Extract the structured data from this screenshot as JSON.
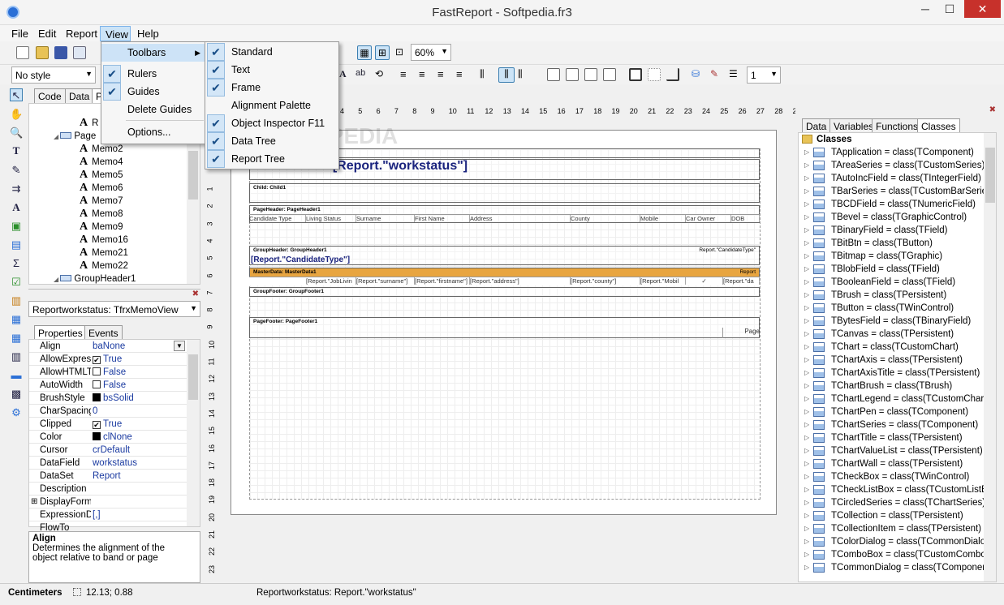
{
  "window": {
    "title": "FastReport - Softpedia.fr3",
    "min": "─",
    "max": "☐",
    "close": "✕"
  },
  "menubar": [
    "File",
    "Edit",
    "Report",
    "View",
    "Help"
  ],
  "toolbar": {
    "zoom": "60%",
    "style": "No style",
    "frame_width": "1"
  },
  "tree_tabs": [
    "Code",
    "Data",
    "P"
  ],
  "tree_items": [
    "R",
    "Page",
    "Memo2",
    "Memo4",
    "Memo5",
    "Memo6",
    "Memo7",
    "Memo8",
    "Memo9",
    "Memo16",
    "Memo21",
    "Memo22",
    "GroupHeader1"
  ],
  "object_selector": "Reportworkstatus: TfrxMemoView",
  "prop_tabs": [
    "Properties",
    "Events"
  ],
  "properties": [
    {
      "name": "Align",
      "value": "baNone",
      "kind": "drop"
    },
    {
      "name": "AllowExpress",
      "value": "True",
      "kind": "check"
    },
    {
      "name": "AllowHTMLTa",
      "value": "False",
      "kind": "uncheck"
    },
    {
      "name": "AutoWidth",
      "value": "False",
      "kind": "uncheck"
    },
    {
      "name": "BrushStyle",
      "value": "bsSolid",
      "kind": "swatch"
    },
    {
      "name": "CharSpacing",
      "value": "0",
      "kind": "text"
    },
    {
      "name": "Clipped",
      "value": "True",
      "kind": "check"
    },
    {
      "name": "Color",
      "value": "clNone",
      "kind": "swatch"
    },
    {
      "name": "Cursor",
      "value": "crDefault",
      "kind": "text"
    },
    {
      "name": "DataField",
      "value": "workstatus",
      "kind": "text"
    },
    {
      "name": "DataSet",
      "value": "Report",
      "kind": "text"
    },
    {
      "name": "Description",
      "value": "",
      "kind": "text"
    },
    {
      "name": "DisplayForma",
      "value": "",
      "kind": "expand"
    },
    {
      "name": "ExpressionDe",
      "value": "[,]",
      "kind": "text"
    },
    {
      "name": "FlowTo",
      "value": "",
      "kind": "text"
    }
  ],
  "help": {
    "title": "Align",
    "text": "Determines the alignment of the object relative to band or page"
  },
  "ruler_h": [
    "4",
    "5",
    "6",
    "7",
    "8",
    "9",
    "10",
    "11",
    "12",
    "13",
    "14",
    "15",
    "16",
    "17",
    "18",
    "19",
    "20",
    "21",
    "22",
    "23",
    "24",
    "25",
    "26",
    "27",
    "28",
    "29"
  ],
  "ruler_v": [
    "1",
    "2",
    "3",
    "4",
    "5",
    "6",
    "7",
    "8",
    "9",
    "10",
    "11",
    "12",
    "13",
    "14",
    "15",
    "16",
    "17",
    "18",
    "19",
    "20",
    "21",
    "22",
    "23"
  ],
  "report": {
    "title_memo": "Work Status: [Report.\"workstatus\"]",
    "child": "Child: Child1",
    "page_header": "PageHeader: PageHeader1",
    "columns": [
      "Candidate Type",
      "Living Status",
      "Surname",
      "First Name",
      "Address",
      "County",
      "Mobile",
      "Car Owner",
      "DOB"
    ],
    "group_header": "GroupHeader: GroupHeader1",
    "group_cond": "Report.\"CandidateType\"",
    "group_memo": "[Report.\"CandidateType\"]",
    "master_data": "MasterData: MasterData1",
    "master_right": "Report",
    "fields": [
      "[Report.\"JobLivin",
      "[Report.\"surname\"]",
      "[Report.\"firstname\"]",
      "[Report.\"address\"]",
      "[Report.\"county\"]",
      "[Report.\"Mobil",
      "✓",
      "[Report.\"da"
    ],
    "group_footer": "GroupFooter: GroupFooter1",
    "page_footer": "PageFooter: PageFooter1",
    "page_memo": "Page"
  },
  "right_tabs": [
    "Data",
    "Variables",
    "Functions",
    "Classes"
  ],
  "classes_root": "Classes",
  "classes": [
    "TApplication = class(TComponent)",
    "TAreaSeries = class(TCustomSeries)",
    "TAutoIncField = class(TIntegerField)",
    "TBarSeries = class(TCustomBarSeries)",
    "TBCDField = class(TNumericField)",
    "TBevel = class(TGraphicControl)",
    "TBinaryField = class(TField)",
    "TBitBtn = class(TButton)",
    "TBitmap = class(TGraphic)",
    "TBlobField = class(TField)",
    "TBooleanField = class(TField)",
    "TBrush = class(TPersistent)",
    "TButton = class(TWinControl)",
    "TBytesField = class(TBinaryField)",
    "TCanvas = class(TPersistent)",
    "TChart = class(TCustomChart)",
    "TChartAxis = class(TPersistent)",
    "TChartAxisTitle = class(TPersistent)",
    "TChartBrush = class(TBrush)",
    "TChartLegend = class(TCustomChartLe",
    "TChartPen = class(TComponent)",
    "TChartSeries = class(TComponent)",
    "TChartTitle = class(TPersistent)",
    "TChartValueList = class(TPersistent)",
    "TChartWall = class(TPersistent)",
    "TCheckBox = class(TWinControl)",
    "TCheckListBox = class(TCustomListBox",
    "TCircledSeries = class(TChartSeries)",
    "TCollection = class(TPersistent)",
    "TCollectionItem = class(TPersistent)",
    "TColorDialog = class(TCommonDialog)",
    "TComboBox = class(TCustomComboBo",
    "TCommonDialog = class(TComponent)"
  ],
  "status": {
    "units": "Centimeters",
    "coords": "12.13; 0.88",
    "object": "Reportworkstatus: Report.\"workstatus\""
  },
  "view_menu": {
    "toolbars": "Toolbars",
    "rulers": "Rulers",
    "guides": "Guides",
    "delete_guides": "Delete Guides",
    "options": "Options..."
  },
  "toolbars_menu": [
    {
      "label": "Standard",
      "checked": true
    },
    {
      "label": "Text",
      "checked": true
    },
    {
      "label": "Frame",
      "checked": true
    },
    {
      "label": "Alignment Palette",
      "checked": false
    },
    {
      "label": "Object Inspector F11",
      "checked": true
    },
    {
      "label": "Data Tree",
      "checked": true
    },
    {
      "label": "Report Tree",
      "checked": true
    }
  ],
  "watermark": "SOFTPEDIA"
}
